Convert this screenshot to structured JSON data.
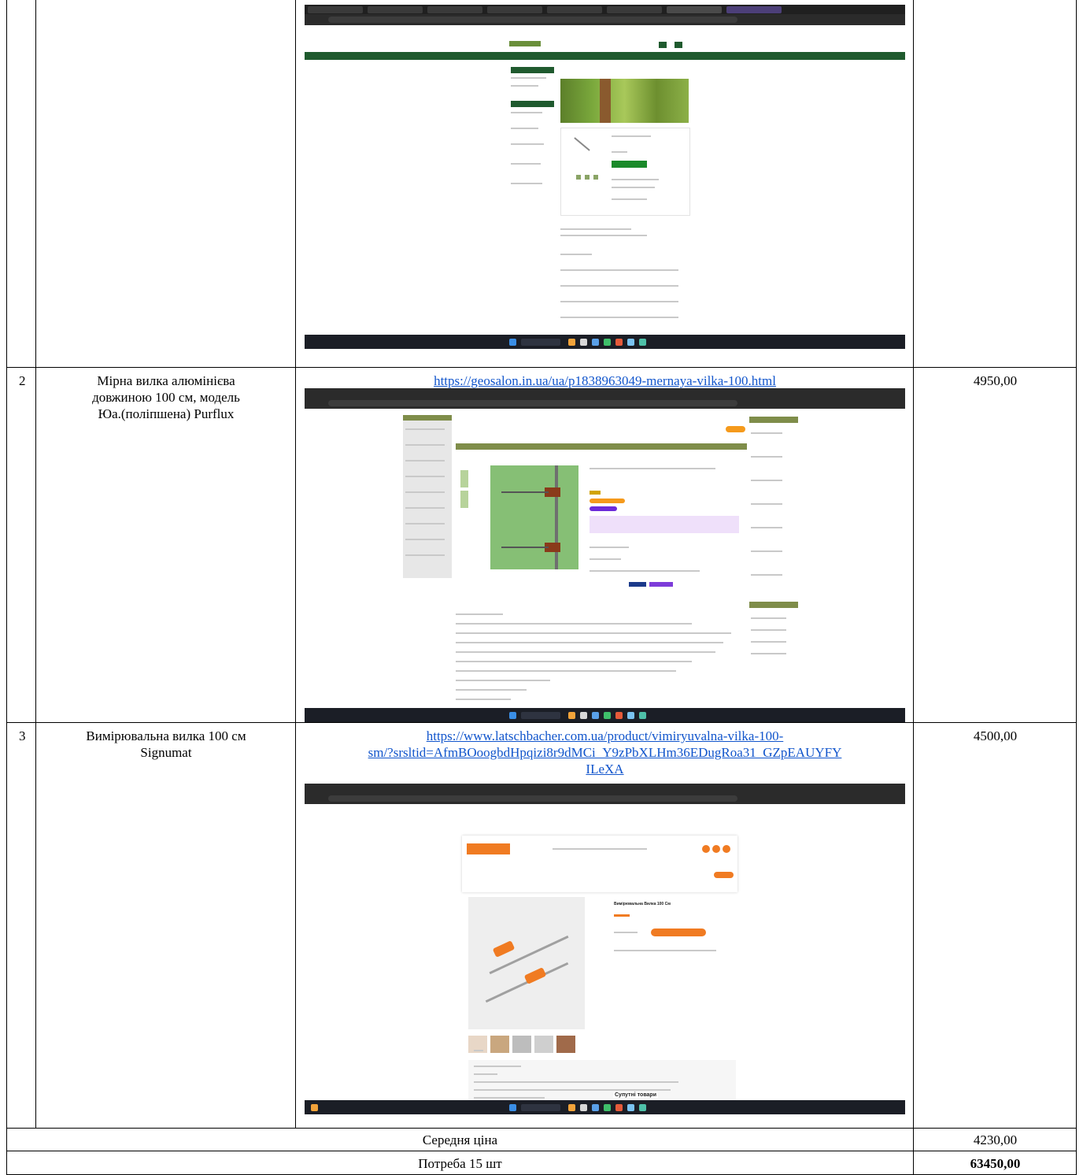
{
  "rows": [
    {
      "number": "",
      "name": "",
      "url": "",
      "price": ""
    },
    {
      "number": "2",
      "name_lines": [
        "Мірна вилка алюмінієва",
        "довжиною 100 см, модель",
        "Юа.(поліпшена) Purflux"
      ],
      "url": "https://geosalon.in.ua/ua/p1838963049-mernaya-vilka-100.html",
      "price": "4950,00"
    },
    {
      "number": "3",
      "name_lines": [
        "Вимірювальна вилка 100 см",
        "Signumat"
      ],
      "url_lines": [
        "https://www.latschbacher.com.ua/product/vimiryuvalna-vilka-100-",
        "sm/?srsltid=AfmBOoogbdHpqizi8r9dMCi_Y9zPbXLHm36EDugRoa31_GZpEAUYFY",
        "ILeXA"
      ],
      "price": "4500,00"
    }
  ],
  "summary": {
    "average_label": "Середня ціна",
    "average_value": "4230,00",
    "need_label": "Потреба 15 шт",
    "need_value": "63450,00"
  },
  "screenshots": {
    "shot3_heading": "Вимірювальна Вилка 100 См",
    "shot3_related": "Супутні товари"
  },
  "colors": {
    "link": "#1155cc",
    "geo_green": "#1f5a2e",
    "olive_bar": "#7f8d4a",
    "orange": "#f07b22"
  }
}
